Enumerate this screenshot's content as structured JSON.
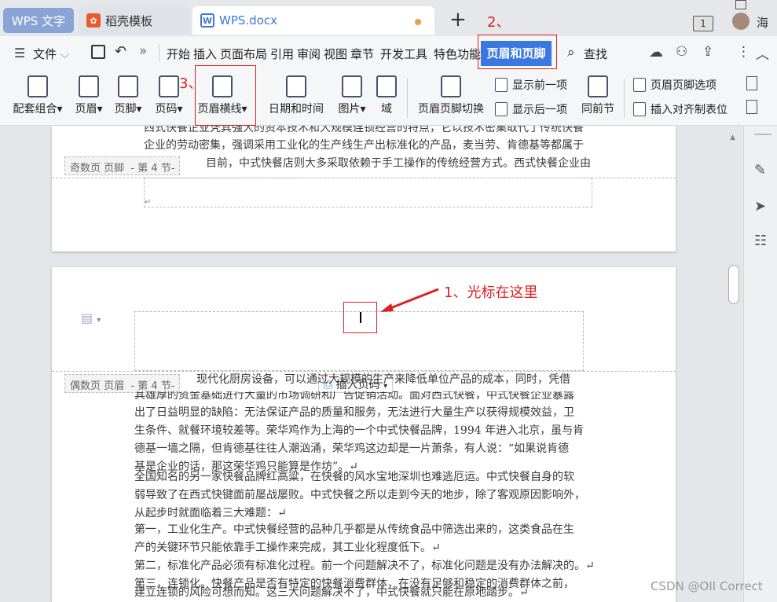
{
  "tabs": {
    "wps": "WPS 文字",
    "docer": "稻壳模板",
    "doc": "WPS.docx",
    "add": "+"
  },
  "window": {
    "badge": "1",
    "user": "海"
  },
  "annotations": {
    "a1": "1、光标在这里",
    "a2": "2、",
    "a3": "3、"
  },
  "menubar": {
    "file": "文件",
    "items": [
      "开始",
      "插入",
      "页面布局",
      "引用",
      "审阅",
      "视图",
      "章节",
      "开发工具",
      "特色功能"
    ],
    "active": "页眉和页脚",
    "search": "查找"
  },
  "ribbon": {
    "set_combo": "配套组合",
    "header": "页眉",
    "footer": "页脚",
    "page_number": "页码",
    "header_line": "页眉横线",
    "date_time": "日期和时间",
    "picture": "图片",
    "field": "域",
    "switch": "页眉页脚切换",
    "prev": "显示前一项",
    "next": "显示后一项",
    "same_as_prev": "同前节",
    "options": "页眉页脚选项",
    "align_tab": "插入对齐制表位"
  },
  "page1": {
    "lines": [
      "西式快餐企业凭其强大的资本技术和大规模连锁经营的特点，它以技术密集取代了传统快餐",
      "企业的劳动密集，强调采用工业化的生产线生产出标准化的产品，麦当劳、肯德基等都属于",
      "目前，中式快餐店则大多采取依赖于手工操作的传统经营方式。西式快餐企业由"
    ],
    "footer_tag": "奇数页 页脚",
    "section": "- 第 4 节-"
  },
  "page2": {
    "header_tag": "偶数页 页眉",
    "section": "- 第 4 节-",
    "insert_page_number": "插入页码",
    "lines": [
      "现代化厨房设备，可以通过大规模的生产来降低单位产品的成本，同时，凭借",
      "其雄厚的资金基础进行大量的市场调研和广告促销活动。面对西式快餐，中式快餐企业暴露",
      "出了日益明显的缺陷：无法保证产品的质量和服务，无法进行大量生产以获得规模效益，卫",
      "生条件、就餐环境较差等。荣华鸡作为上海的一个中式快餐品牌，1994 年进入北京，虽与肯",
      "德基一墙之隔，但肯德基往往人潮汹涌，荣华鸡这边却是一片萧条，有人说：“如果说肯德",
      "基是企业的话，那这荣华鸡只能算是作坊”。↵",
      "全国知名的另一家快餐品牌红高粱，在快餐的风水宝地深圳也难逃厄运。中式快餐自身的软",
      "弱导致了在西式快键面前屡战屡败。中式快餐之所以走到今天的地步，除了客观原因影响外，",
      "从起步时就面临着三大难题：↵",
      "第一，工业化生产。中式快餐经营的品种几乎都是从传统食品中筛选出来的，这类食品在生",
      "产的关键环节只能依靠手工操作来完成，其工业化程度低下。↵",
      "第二，标准化产品必须有标准化过程。前一个问题解决不了，标准化问题是没有办法解决的。↵",
      "第三，连锁化。快餐产品是否有特定的快餐消费群体，在没有足够和稳定的消费群体之前，",
      "建立连锁的风险可想而知。这三大问题解决不了，中式快餐就只能在原地踏步。↵"
    ]
  },
  "watermark": "CSDN @OII Correct"
}
